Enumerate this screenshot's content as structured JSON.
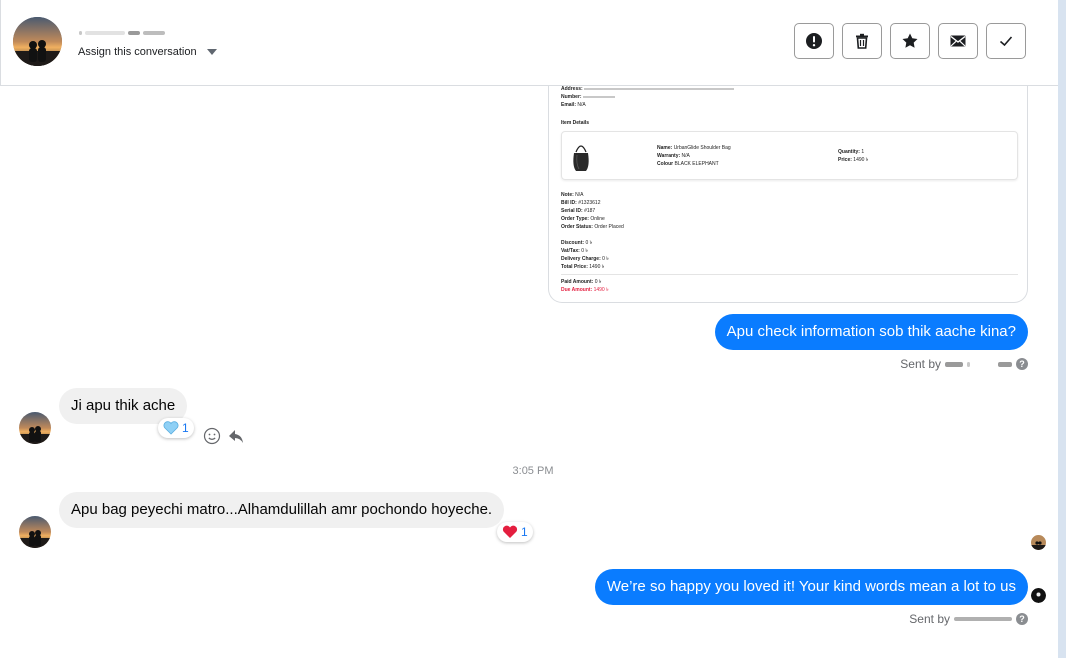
{
  "header": {
    "contact_name": "",
    "assign_label": "Assign this conversation",
    "buttons": [
      {
        "name": "spam-button",
        "icon": "alert-icon"
      },
      {
        "name": "delete-button",
        "icon": "trash-icon"
      },
      {
        "name": "star-button",
        "icon": "star-icon"
      },
      {
        "name": "mark-unread-button",
        "icon": "envelope-icon"
      },
      {
        "name": "mark-done-button",
        "icon": "check-icon"
      }
    ]
  },
  "order": {
    "address_label": "Address:",
    "number_label": "Number:",
    "email_label": "Email:",
    "email_value": "N/A",
    "item_details_title": "Item Details",
    "item": {
      "name_label": "Name:",
      "name_value": "UrbanGlide Shoulder Bag",
      "warranty_label": "Warranty:",
      "warranty_value": "N/A",
      "colour_label": "Colour",
      "colour_value": "BLACK ELEPHANT",
      "quantity_label": "Quantity:",
      "quantity_value": "1",
      "price_label": "Price:",
      "price_value": "1490 ৳"
    },
    "note_label": "Note:",
    "note_value": "N/A",
    "bill_id_label": "Bill ID:",
    "bill_id_value": "#1323612",
    "serial_id_label": "Serial ID:",
    "serial_id_value": "#187",
    "order_type_label": "Order Type:",
    "order_type_value": "Online",
    "order_status_label": "Order Status:",
    "order_status_value": "Order Placed",
    "discount_label": "Discount:",
    "discount_value": "0 ৳",
    "vat_label": "Vat/Tax:",
    "vat_value": "0 ৳",
    "delivery_label": "Delivery Charge:",
    "delivery_value": "0 ৳",
    "total_label": "Total Price:",
    "total_value": "1490 ৳",
    "paid_label": "Paid Amount:",
    "paid_value": "0 ৳",
    "due_label": "Due Amount:",
    "due_value": "1490 ৳"
  },
  "messages": {
    "m1_text": "Apu check information sob thik aache kina?",
    "m1_sentby": "Sent by",
    "m2_text": "Ji apu thik ache",
    "m2_reaction_count": "1",
    "timestamp": "3:05 PM",
    "m3_text": "Apu bag peyechi matro...Alhamdulillah amr pochondo hoyeche.",
    "m3_reaction_count": "1",
    "m4_text": "We’re so happy you loved it! Your kind words mean a lot to us",
    "m4_sentby": "Sent by",
    "help_mark": "?"
  },
  "colors": {
    "outgoing": "#0a7cff",
    "incoming": "#f0f0f0",
    "due": "#e41e3f"
  }
}
